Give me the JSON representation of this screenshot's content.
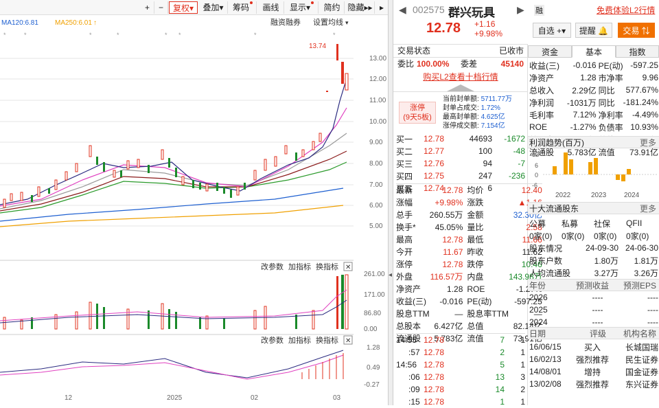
{
  "toolbar": {
    "items": [
      "复权",
      "叠加",
      "筹码",
      "画线",
      "显示",
      "简约",
      "隐藏"
    ]
  },
  "ma": {
    "ma120": "MA120:6.81",
    "ma250": "MA250:6.01",
    "margin": "融资融券",
    "settings": "设置均线"
  },
  "chart_labels": {
    "high": "13.74",
    "yticks": [
      "13.00",
      "12.00",
      "11.00",
      "10.00",
      "9.00",
      "8.00",
      "7.00",
      "6.00",
      "5.00"
    ],
    "sub_tools": [
      "改参数",
      "加指标",
      "换指标"
    ],
    "vol_ticks": [
      "261.00",
      "171.00",
      "86.80",
      "0.00"
    ],
    "macd_ticks": [
      "1.28",
      "0.49",
      "-0.27"
    ],
    "xticks": [
      "12",
      "2025",
      "02",
      "03"
    ]
  },
  "stock": {
    "code": "002575",
    "name": "群兴玩具",
    "price": "12.78",
    "change": "+1.16",
    "pct": "+9.98%",
    "rong": "融",
    "l2": "免费体验L2行情",
    "zixuan": "自选",
    "tixing": "提醒",
    "jiaoyi": "交易"
  },
  "status": {
    "label": "交易状态",
    "value": "已收市",
    "wb_label": "委比",
    "wb": "100.00%",
    "wc_label": "委差",
    "wc": "45140",
    "l2_link": "购买L2查看十档行情"
  },
  "limit": {
    "badge1": "涨停",
    "badge2": "(9天5板)",
    "lines": [
      [
        "当前封单额:",
        "5711.77万"
      ],
      [
        "封单占成交:",
        "1.72%"
      ],
      [
        "最高封单额:",
        "4.625亿"
      ],
      [
        "涨停成交额:",
        "7.154亿"
      ]
    ]
  },
  "order_book": [
    [
      "买一",
      "12.78",
      "44693",
      "-1672"
    ],
    [
      "买二",
      "12.77",
      "100",
      "-48"
    ],
    [
      "买三",
      "12.76",
      "94",
      "-7"
    ],
    [
      "买四",
      "12.75",
      "247",
      "-236"
    ],
    [
      "买五",
      "12.74",
      "6",
      ""
    ]
  ],
  "quote": [
    [
      "最新",
      "12.78",
      "均价",
      "12.40"
    ],
    [
      "涨幅",
      "+9.98%",
      "涨跌",
      "▲1.16"
    ],
    [
      "总手",
      "260.55万",
      "金额",
      "32.30亿"
    ],
    [
      "换手*",
      "45.05%",
      "量比",
      "2.58"
    ],
    [
      "最高",
      "12.78",
      "最低",
      "11.66"
    ],
    [
      "今开",
      "11.67",
      "昨收",
      "11.62"
    ],
    [
      "涨停",
      "12.78",
      "跌停",
      "10.46"
    ],
    [
      "外盘",
      "116.57万",
      "内盘",
      "143.98万"
    ],
    [
      "净资产",
      "1.28",
      "ROE",
      "-1.27%"
    ],
    [
      "收益(三)",
      "-0.016",
      "PE(动)",
      "-597.25"
    ],
    [
      "股息TTM",
      "—",
      "股息率TTM",
      "—"
    ],
    [
      "总股本",
      "6.427亿",
      "总值",
      "82.14亿"
    ],
    [
      "流通股",
      "5.783亿",
      "流值",
      "73.91亿"
    ]
  ],
  "trades": [
    [
      "14:55",
      "12.78",
      "7",
      "1"
    ],
    [
      ":57",
      "12.78",
      "2",
      "1"
    ],
    [
      "14:56",
      "12.78",
      "5",
      "1"
    ],
    [
      ":06",
      "12.78",
      "13",
      "3"
    ],
    [
      ":09",
      "12.78",
      "14",
      "2"
    ],
    [
      ":15",
      "12.78",
      "1",
      "1"
    ]
  ],
  "tabs": [
    "资金",
    "基本",
    "指数"
  ],
  "fund": [
    [
      "收益(三)",
      "-0.016",
      "PE(动)",
      "-597.25"
    ],
    [
      "净资产",
      "1.28",
      "市净率",
      "9.96"
    ],
    [
      "总收入",
      "2.29亿",
      "同比",
      "577.67%"
    ],
    [
      "净利润",
      "-1031万",
      "同比",
      "-181.24%"
    ],
    [
      "毛利率",
      "7.12%",
      "净利率",
      "-4.49%"
    ],
    [
      "ROE",
      "-1.27%",
      "负债率",
      "10.93%"
    ],
    [
      "总股本",
      "6.427亿",
      "总值",
      "82.14亿"
    ],
    [
      "流通股",
      "5.783亿",
      "流值",
      "73.91亿"
    ]
  ],
  "profit": {
    "title": "利润趋势(百万)",
    "more": "更多",
    "yticks": [
      "12",
      "6",
      "0",
      "-6"
    ],
    "years": [
      "2022",
      "2023",
      "2024"
    ]
  },
  "holders": {
    "title": "十大流通股东",
    "more": "更多",
    "cols": [
      "公募",
      "私募",
      "社保",
      "QFII"
    ],
    "vals": [
      "0家(0)",
      "0家(0)",
      "0家(0)",
      "0家(0)"
    ],
    "rows": [
      [
        "股东情况",
        "24-09-30",
        "24-06-30"
      ],
      [
        "股东户数",
        "1.80万",
        "1.81万"
      ],
      [
        "人均流通股",
        "3.27万",
        "3.26万"
      ]
    ]
  },
  "forecast": {
    "cols": [
      "年份",
      "预测收益",
      "预测EPS"
    ],
    "rows": [
      [
        "2026",
        "----",
        "----"
      ],
      [
        "2025",
        "----",
        "----"
      ],
      [
        "2024",
        "----",
        "----"
      ]
    ]
  },
  "ratings": {
    "cols": [
      "日期",
      "评级",
      "机构名称"
    ],
    "rows": [
      [
        "16/06/15",
        "买入",
        "长城国瑞"
      ],
      [
        "16/02/13",
        "强烈推荐",
        "民生证券"
      ],
      [
        "14/08/01",
        "增持",
        "国金证券"
      ],
      [
        "13/02/08",
        "强烈推荐",
        "东兴证券"
      ]
    ]
  },
  "colors": {
    "up": "#e0301e",
    "down": "#1a8a2a",
    "accent": "#f07000"
  }
}
